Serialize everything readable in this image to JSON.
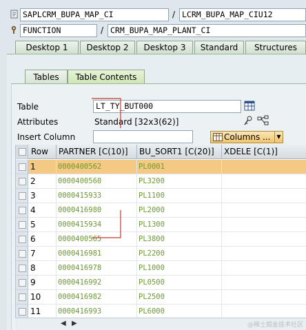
{
  "header": {
    "program": "SAPLCRM_BUPA_MAP_CI",
    "include": "LCRM_BUPA_MAP_CIU12",
    "type": "FUNCTION",
    "name": "CRM_BUPA_MAP_PLANT_CI",
    "sep": "/"
  },
  "tabs": [
    "Desktop 1",
    "Desktop 2",
    "Desktop 3",
    "Standard",
    "Structures"
  ],
  "subtabs": [
    "Tables",
    "Table Contents"
  ],
  "form": {
    "table_label": "Table",
    "table_value": "LT_TY_BUT000",
    "attributes_label": "Attributes",
    "attributes_value": "Standard [32x3(62)]",
    "insert_column_label": "Insert Column",
    "insert_column_value": "",
    "columns_button": "Columns ..."
  },
  "grid": {
    "headers": [
      "Row",
      "PARTNER [C(10)]",
      "BU_SORT1 [C(20)]",
      "XDELE [C(1)]"
    ],
    "rows": [
      [
        "1",
        "0000400562",
        "PL0001",
        ""
      ],
      [
        "2",
        "0000400560",
        "PL3200",
        ""
      ],
      [
        "3",
        "0000415933",
        "PL1100",
        ""
      ],
      [
        "4",
        "0000416980",
        "PL2000",
        ""
      ],
      [
        "5",
        "0000415934",
        "PL1300",
        ""
      ],
      [
        "6",
        "0000400565",
        "PL3800",
        ""
      ],
      [
        "7",
        "0000416981",
        "PL2200",
        ""
      ],
      [
        "8",
        "0000416978",
        "PL1000",
        ""
      ],
      [
        "9",
        "0000416992",
        "PL0500",
        ""
      ],
      [
        "10",
        "0000416982",
        "PL2500",
        ""
      ],
      [
        "11",
        "0000416993",
        "PL6000",
        ""
      ]
    ],
    "selected_row": 1
  },
  "watermark": "@稀土掘金技术社区",
  "colors": {
    "accent_selected_row": "#f3c983",
    "cell_value": "#6b9b2f",
    "tab_active": "#d9ecc2",
    "annotation_red": "#c0392b"
  },
  "icons": [
    "document-icon",
    "gear-icon",
    "table-icon",
    "details-icon",
    "share-icon",
    "columns-icon",
    "dropdown-arrow-icon",
    "scroll-left-icon",
    "scroll-right-icon"
  ]
}
